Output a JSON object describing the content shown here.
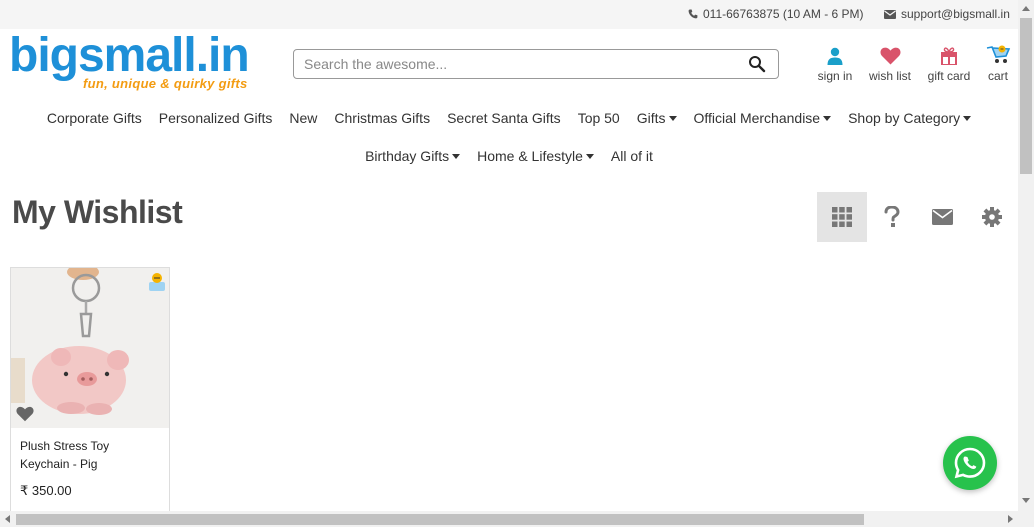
{
  "topbar": {
    "phone": "011-66763875 (10 AM - 6 PM)",
    "email": "support@bigsmall.in"
  },
  "logo": {
    "word": "bigsmall.in",
    "tagline": "fun, unique & quirky gifts"
  },
  "search": {
    "placeholder": "Search the awesome..."
  },
  "header_icons": [
    {
      "label": "sign in",
      "icon": "user-icon",
      "color": "#1a9fc9"
    },
    {
      "label": "wish list",
      "icon": "heart-icon",
      "color": "#d9536a"
    },
    {
      "label": "gift card",
      "icon": "gift-icon",
      "color": "#d9536a"
    },
    {
      "label": "cart",
      "icon": "cart-icon",
      "color": "#1e90d8"
    }
  ],
  "nav": {
    "row1": [
      {
        "label": "Corporate Gifts",
        "dropdown": false
      },
      {
        "label": "Personalized Gifts",
        "dropdown": false
      },
      {
        "label": "New",
        "dropdown": false
      },
      {
        "label": "Christmas Gifts",
        "dropdown": false
      },
      {
        "label": "Secret Santa Gifts",
        "dropdown": false
      },
      {
        "label": "Top 50",
        "dropdown": false
      },
      {
        "label": "Gifts",
        "dropdown": true
      },
      {
        "label": "Official Merchandise",
        "dropdown": true
      },
      {
        "label": "Shop by Category",
        "dropdown": true
      }
    ],
    "row2": [
      {
        "label": "Birthday Gifts",
        "dropdown": true
      },
      {
        "label": "Home & Lifestyle",
        "dropdown": true
      },
      {
        "label": "All of it",
        "dropdown": false
      }
    ]
  },
  "page": {
    "title": "My Wishlist"
  },
  "tools": [
    {
      "icon": "grid-icon",
      "active": true
    },
    {
      "icon": "help-icon",
      "active": false
    },
    {
      "icon": "envelope-icon",
      "active": false
    },
    {
      "icon": "gear-icon",
      "active": false
    }
  ],
  "products": [
    {
      "name": "Plush Stress Toy Keychain - Pig",
      "price": "₹ 350.00"
    }
  ],
  "colors": {
    "brand_blue": "#1e90d8",
    "brand_orange": "#f39c12",
    "whatsapp_green": "#27c24c"
  }
}
